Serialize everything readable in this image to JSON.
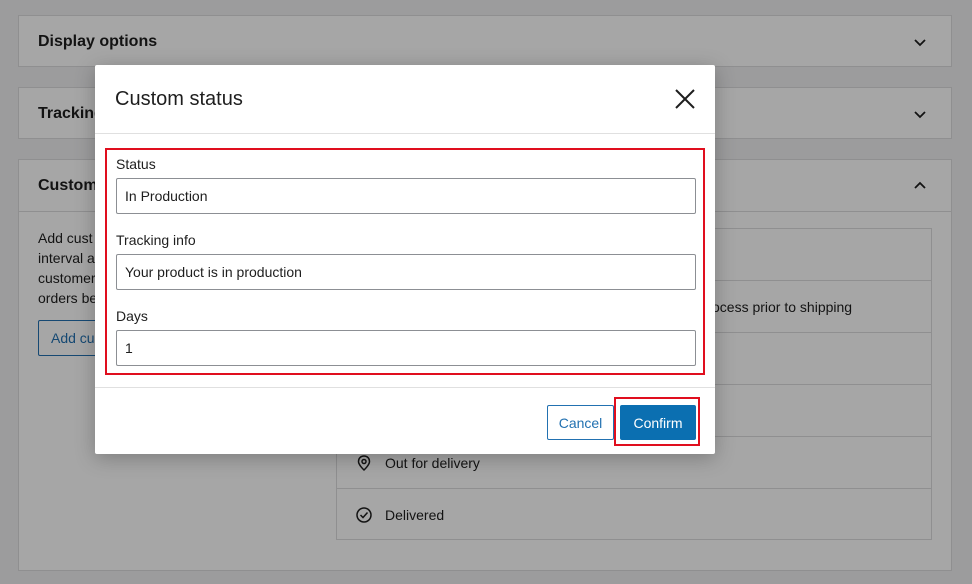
{
  "background": {
    "panels": [
      {
        "title": "Display options"
      },
      {
        "title": "Tracking"
      },
      {
        "title": "Custom"
      }
    ],
    "description_lines": [
      "Add cust",
      "interval a",
      "customer",
      "orders be"
    ],
    "add_button_label": "Add cu",
    "rows": [
      {
        "label": ""
      },
      {
        "label": "r process prior to shipping"
      },
      {
        "label": ""
      },
      {
        "label": ""
      },
      {
        "label": "Out for delivery",
        "icon": "map-pin-icon"
      },
      {
        "label": "Delivered",
        "icon": "check-circle-icon"
      }
    ]
  },
  "modal": {
    "title": "Custom status",
    "fields": {
      "status": {
        "label": "Status",
        "value": "In Production"
      },
      "tracking": {
        "label": "Tracking info",
        "value": "Your product is in production"
      },
      "days": {
        "label": "Days",
        "value": "1"
      }
    },
    "cancel_label": "Cancel",
    "confirm_label": "Confirm"
  },
  "colors": {
    "accent": "#2271b1",
    "primary_button": "#0b6fb1",
    "highlight": "#e00e1e"
  }
}
